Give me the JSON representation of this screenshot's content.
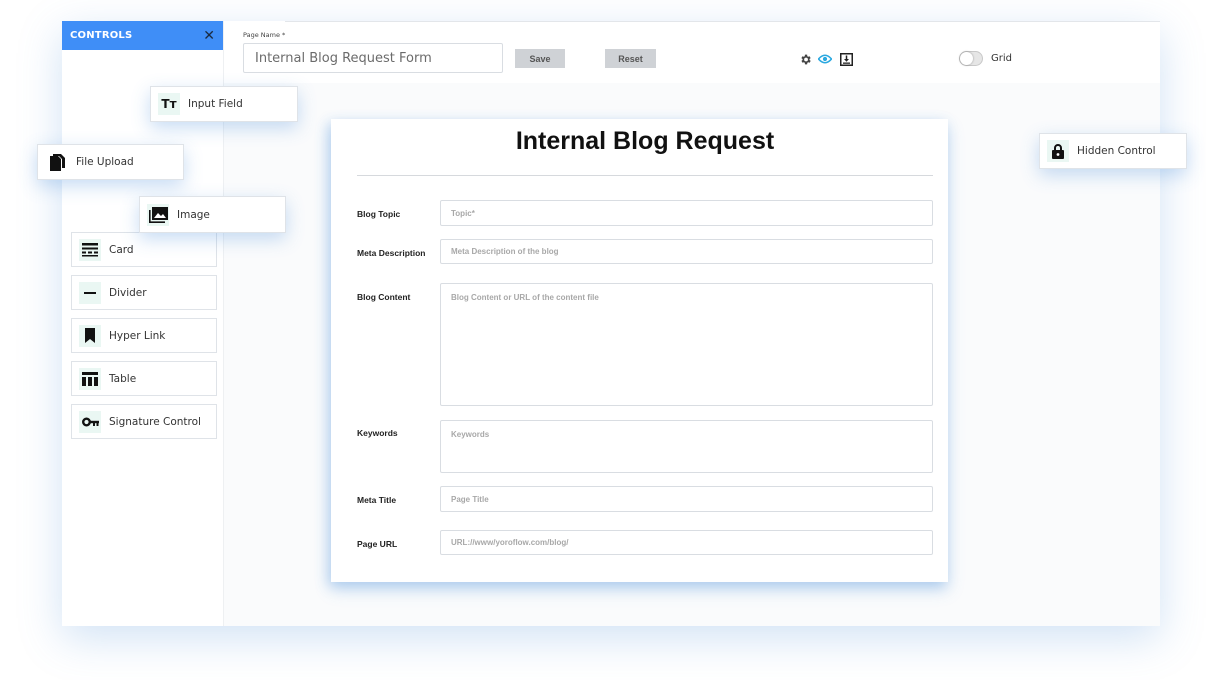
{
  "sidebar": {
    "title": "CONTROLS",
    "close": "✕",
    "docked_items": [
      {
        "label": "Card"
      },
      {
        "label": "Divider"
      },
      {
        "label": "Hyper Link"
      },
      {
        "label": "Table"
      },
      {
        "label": "Signature Control"
      }
    ],
    "floating_items": {
      "input_field": "Input Field",
      "file_upload": "File Upload",
      "image": "Image",
      "hidden_control": "Hidden Control"
    }
  },
  "toolbar": {
    "page_name_label": "Page Name *",
    "page_name_value": "Internal Blog Request Form",
    "save_label": "Save",
    "reset_label": "Reset",
    "grid_label": "Grid",
    "grid_enabled": false,
    "icons": [
      "gear-icon",
      "eye-icon",
      "export-icon"
    ]
  },
  "form": {
    "title": "Internal Blog Request",
    "fields": [
      {
        "label": "Blog Topic",
        "placeholder": "Topic*"
      },
      {
        "label": "Meta Description",
        "placeholder": "Meta Description of the blog"
      },
      {
        "label": "Blog Content",
        "placeholder": "Blog Content or URL of the content file"
      },
      {
        "label": "Keywords",
        "placeholder": "Keywords"
      },
      {
        "label": "Meta Title",
        "placeholder": "Page Title"
      },
      {
        "label": "Page URL",
        "placeholder": "URL://www/yoroflow.com/blog/"
      }
    ]
  },
  "colors": {
    "accent": "#3f8ef7",
    "icon_bg": "#eaf7f3",
    "preview_icon": "#2aa8e0"
  }
}
